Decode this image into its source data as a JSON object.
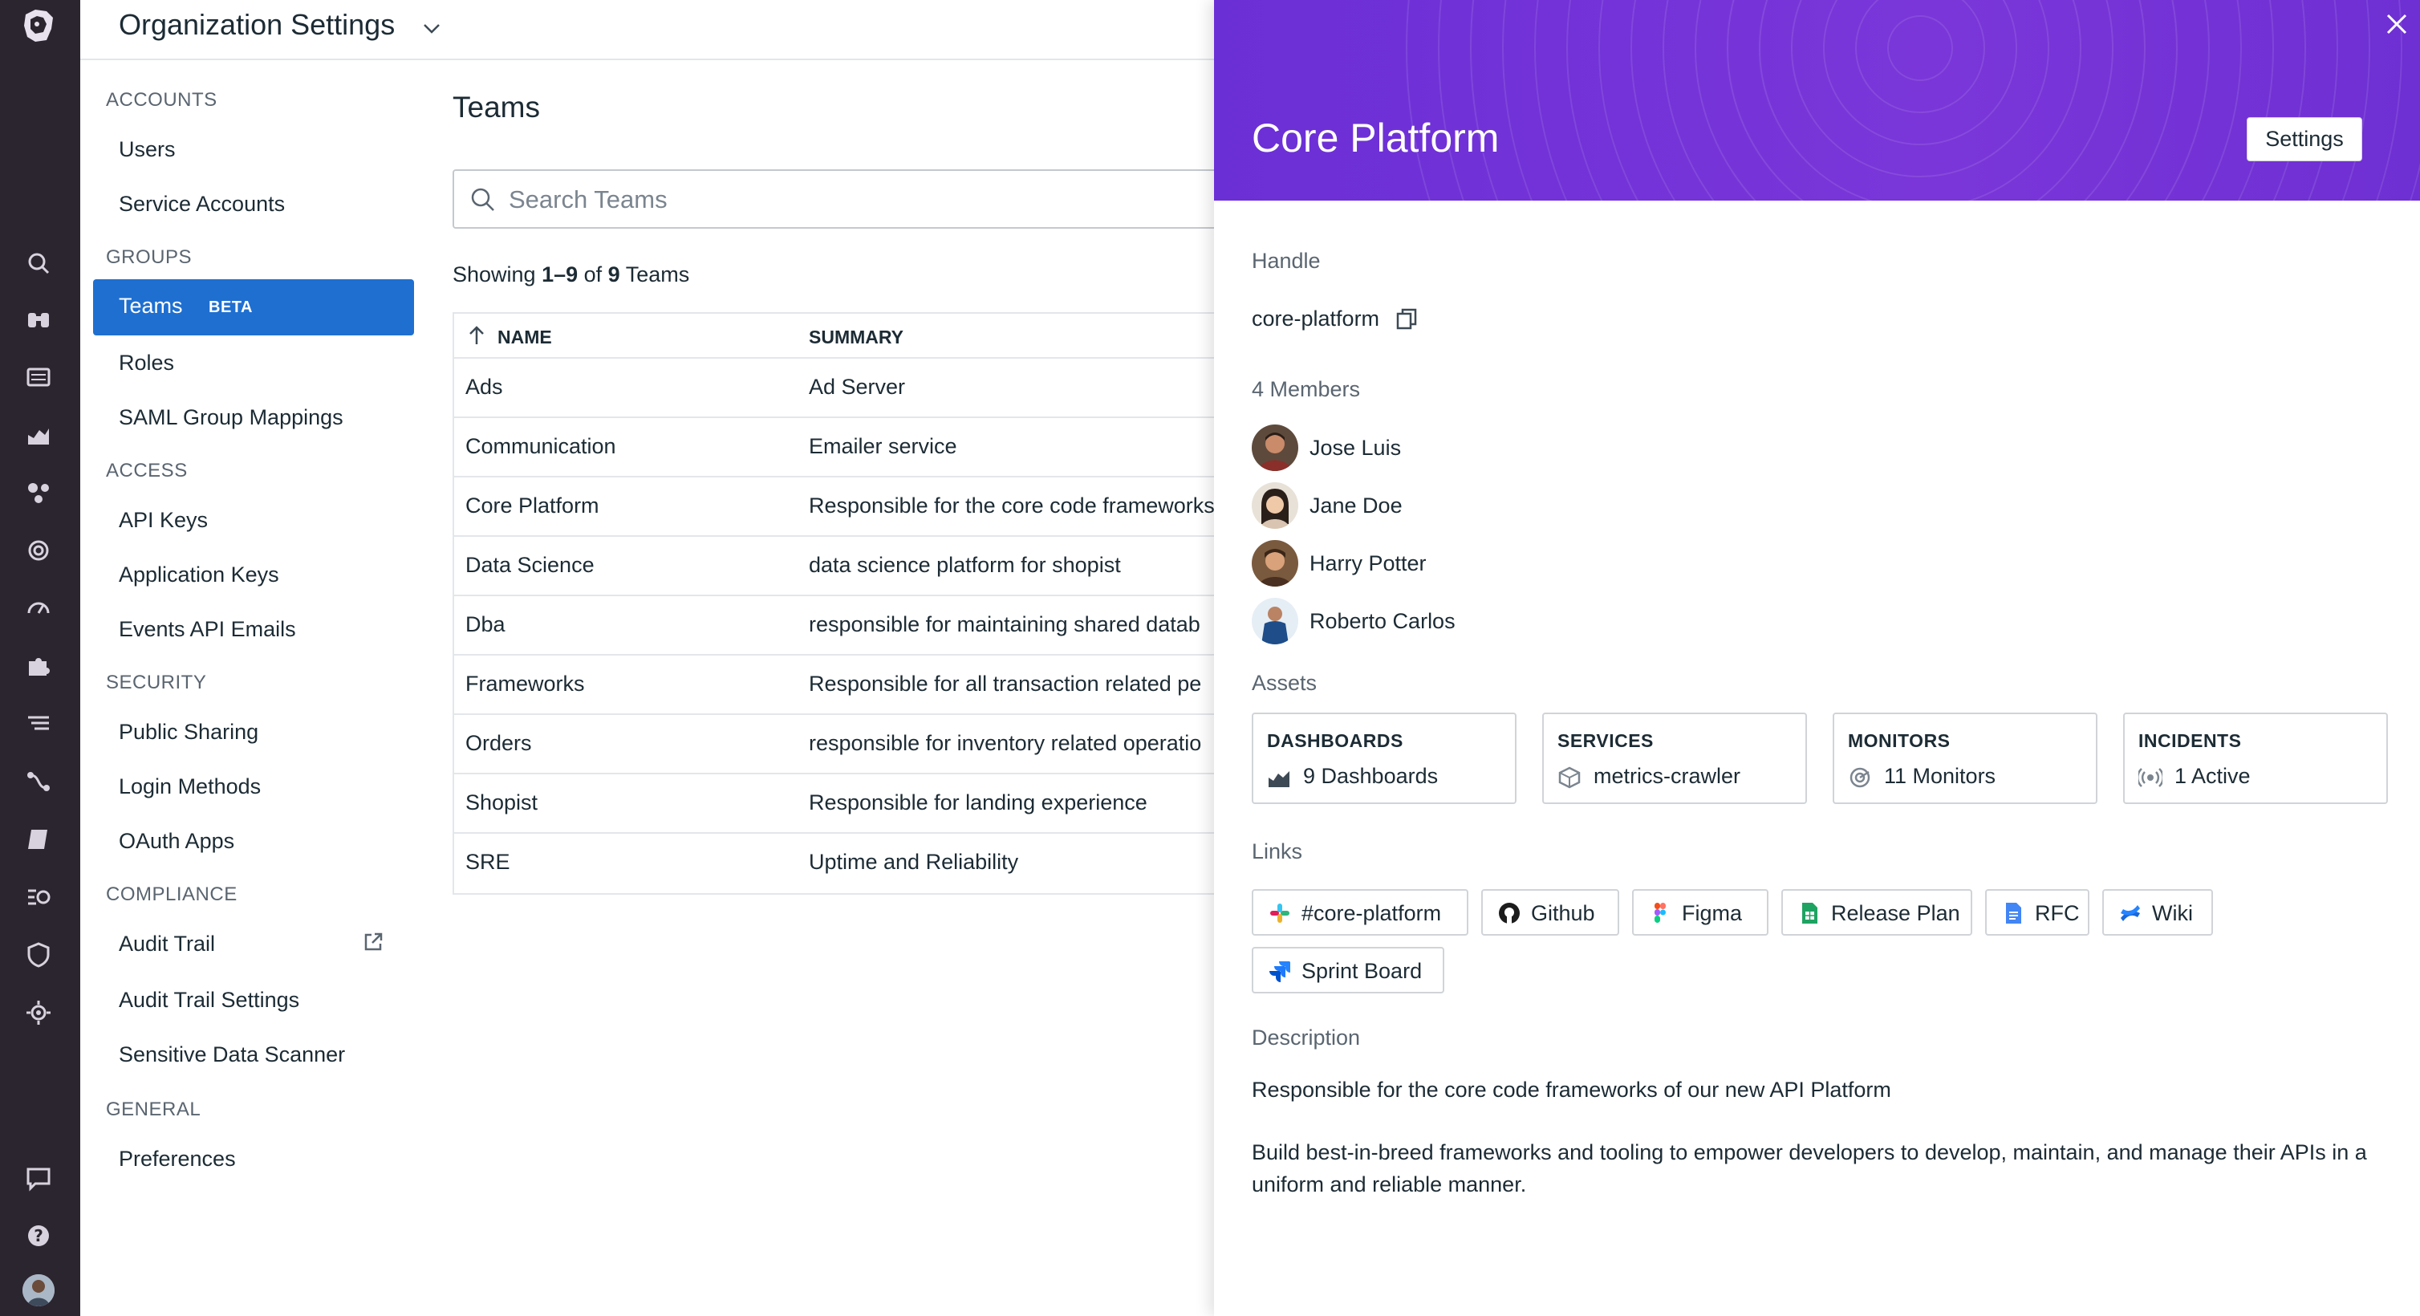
{
  "header": {
    "title": "Organization Settings"
  },
  "nav": {
    "sections": [
      {
        "label": "ACCOUNTS",
        "items": [
          "Users",
          "Service Accounts"
        ]
      },
      {
        "label": "GROUPS",
        "items": [
          "Teams",
          "Roles",
          "SAML Group Mappings"
        ]
      },
      {
        "label": "ACCESS",
        "items": [
          "API Keys",
          "Application Keys",
          "Events API Emails"
        ]
      },
      {
        "label": "SECURITY",
        "items": [
          "Public Sharing",
          "Login Methods",
          "OAuth Apps"
        ]
      },
      {
        "label": "COMPLIANCE",
        "items": [
          "Audit Trail",
          "Audit Trail Settings",
          "Sensitive Data Scanner"
        ]
      },
      {
        "label": "GENERAL",
        "items": [
          "Preferences"
        ]
      }
    ],
    "active_badge": "BETA"
  },
  "main": {
    "title": "Teams",
    "search_placeholder": "Search Teams",
    "showing": {
      "prefix": "Showing ",
      "range": "1–9",
      "mid": " of ",
      "total": "9",
      "suffix": " Teams"
    },
    "columns": [
      "NAME",
      "SUMMARY"
    ],
    "rows": [
      {
        "name": "Ads",
        "summary": "Ad Server"
      },
      {
        "name": "Communication",
        "summary": "Emailer service"
      },
      {
        "name": "Core Platform",
        "summary": "Responsible for the core code frameworks"
      },
      {
        "name": "Data Science",
        "summary": "data science platform for shopist"
      },
      {
        "name": "Dba",
        "summary": "responsible for maintaining shared datab"
      },
      {
        "name": "Frameworks",
        "summary": "Responsible for all transaction related pe"
      },
      {
        "name": "Orders",
        "summary": "responsible for inventory related operatio"
      },
      {
        "name": "Shopist",
        "summary": "Responsible for landing experience"
      },
      {
        "name": "SRE",
        "summary": "Uptime and Reliability"
      }
    ]
  },
  "drawer": {
    "title": "Core Platform",
    "settings_label": "Settings",
    "handle_label": "Handle",
    "handle_value": "core-platform",
    "members_label": "4 Members",
    "members": [
      "Jose Luis",
      "Jane Doe",
      "Harry Potter",
      "Roberto Carlos"
    ],
    "assets_label": "Assets",
    "assets": [
      {
        "title": "DASHBOARDS",
        "value": "9 Dashboards",
        "icon": "dashboard-icon"
      },
      {
        "title": "SERVICES",
        "value": "metrics-crawler",
        "icon": "service-icon"
      },
      {
        "title": "MONITORS",
        "value": "11 Monitors",
        "icon": "monitor-icon"
      },
      {
        "title": "INCIDENTS",
        "value": "1 Active",
        "icon": "incident-icon"
      }
    ],
    "links_label": "Links",
    "links": [
      {
        "label": "#core-platform",
        "icon": "slack-icon"
      },
      {
        "label": "Github",
        "icon": "github-icon"
      },
      {
        "label": "Figma",
        "icon": "figma-icon"
      },
      {
        "label": "Release Plan",
        "icon": "google-sheets-icon"
      },
      {
        "label": "RFC",
        "icon": "google-docs-icon"
      },
      {
        "label": "Wiki",
        "icon": "confluence-icon"
      },
      {
        "label": "Sprint Board",
        "icon": "jira-icon"
      }
    ],
    "description_label": "Description",
    "description": [
      "Responsible for the core code frameworks of our new API Platform",
      "Build best-in-breed frameworks and tooling to empower developers to develop, maintain, and manage their APIs in a uniform and reliable manner."
    ]
  },
  "colors": {
    "accent": "#1e6fd0",
    "drawer_header": "#7434d8",
    "rail": "#2b2530"
  }
}
